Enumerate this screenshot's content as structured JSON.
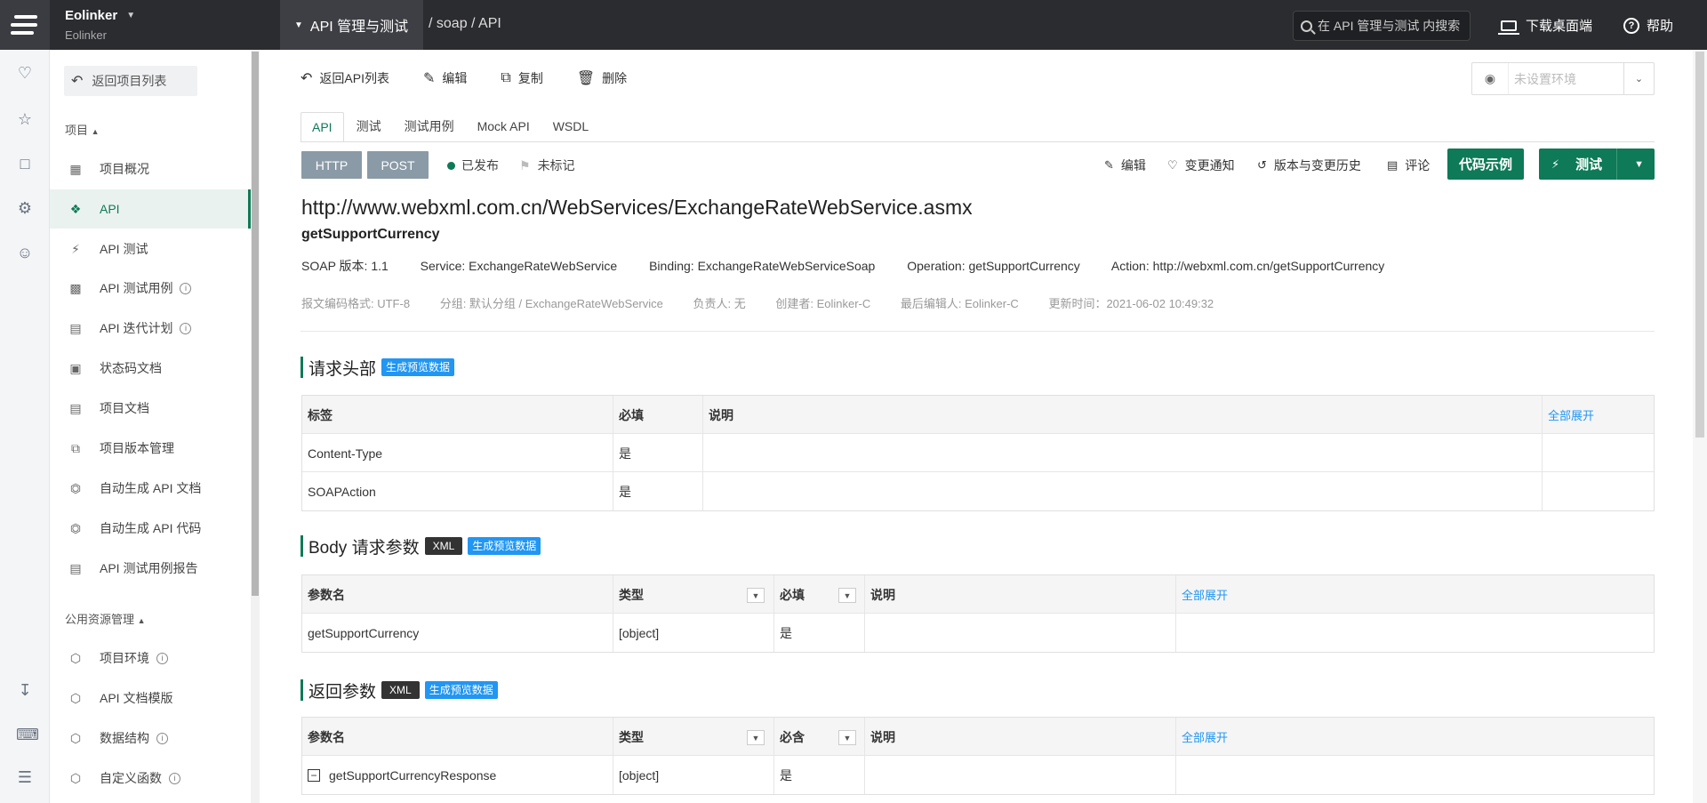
{
  "topbar": {
    "brand": "Eolinker",
    "brand_sub": "Eolinker",
    "module": "API 管理与测试",
    "breadcrumb": "/ soap / API",
    "search_placeholder": "在 API 管理与测试 内搜索",
    "download": "下载桌面端",
    "help": "帮助"
  },
  "sidebar": {
    "back": "返回项目列表",
    "section_project": "项目",
    "section_public": "公用资源管理",
    "items": [
      {
        "label": "项目概况"
      },
      {
        "label": "API"
      },
      {
        "label": "API 测试"
      },
      {
        "label": "API 测试用例"
      },
      {
        "label": "API 迭代计划"
      },
      {
        "label": "状态码文档"
      },
      {
        "label": "项目文档"
      },
      {
        "label": "项目版本管理"
      },
      {
        "label": "自动生成 API 文档"
      },
      {
        "label": "自动生成 API 代码"
      },
      {
        "label": "API 测试用例报告"
      }
    ],
    "public_items": [
      {
        "label": "项目环境"
      },
      {
        "label": "API 文档模版"
      },
      {
        "label": "数据结构"
      },
      {
        "label": "自定义函数"
      }
    ]
  },
  "toolbar": {
    "back_list": "返回API列表",
    "edit": "编辑",
    "copy": "复制",
    "delete": "删除",
    "env_placeholder": "未设置环境"
  },
  "tabs": [
    "API",
    "测试",
    "测试用例",
    "Mock API",
    "WSDL"
  ],
  "api": {
    "protocol": "HTTP",
    "method": "POST",
    "status": "已发布",
    "mark": "未标记",
    "actions": {
      "edit": "编辑",
      "notify": "变更通知",
      "history": "版本与变更历史",
      "comment": "评论",
      "code": "代码示例",
      "test": "测试"
    },
    "url": "http://www.webxml.com.cn/WebServices/ExchangeRateWebService.asmx",
    "operation_name": "getSupportCurrency",
    "meta": {
      "soap_version": "SOAP 版本: 1.1",
      "service": "Service: ExchangeRateWebService",
      "binding": "Binding: ExchangeRateWebServiceSoap",
      "operation": "Operation: getSupportCurrency",
      "action": "Action: http://webxml.com.cn/getSupportCurrency"
    },
    "info": {
      "encoding": "报文编码格式: UTF-8",
      "group": "分组: 默认分组 / ExchangeRateWebService",
      "owner": "负责人: 无",
      "creator": "创建者: Eolinker-C",
      "editor": "最后编辑人: Eolinker-C",
      "updated": "更新时间：2021-06-02 10:49:32"
    }
  },
  "headers_section": {
    "title": "请求头部",
    "preview": "生成预览数据",
    "columns": [
      "标签",
      "必填",
      "说明"
    ],
    "expand_all": "全部展开",
    "rows": [
      {
        "name": "Content-Type",
        "required": "是",
        "desc": ""
      },
      {
        "name": "SOAPAction",
        "required": "是",
        "desc": ""
      }
    ]
  },
  "body_section": {
    "title": "Body 请求参数",
    "format": "XML",
    "preview": "生成预览数据",
    "columns": [
      "参数名",
      "类型",
      "必填",
      "说明"
    ],
    "expand_all": "全部展开",
    "rows": [
      {
        "name": "getSupportCurrency",
        "type": "[object]",
        "required": "是",
        "desc": ""
      }
    ]
  },
  "response_section": {
    "title": "返回参数",
    "format": "XML",
    "preview": "生成预览数据",
    "columns": [
      "参数名",
      "类型",
      "必含",
      "说明"
    ],
    "expand_all": "全部展开",
    "rows": [
      {
        "name": "getSupportCurrencyResponse",
        "type": "[object]",
        "required": "是",
        "desc": ""
      }
    ]
  }
}
